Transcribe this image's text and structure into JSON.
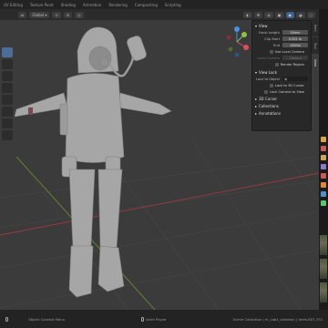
{
  "workspace_tabs": [
    "UV Editing",
    "Texture Paint",
    "Shading",
    "Animation",
    "Rendering",
    "Compositing",
    "Scripting"
  ],
  "viewport_header": {
    "orientation_label": "Global"
  },
  "sidebar": {
    "view_title": "View",
    "focal_length_label": "Focal Length",
    "focal_length_value": "50mm",
    "clip_start_label": "Clip Start",
    "clip_start_value": "0.001 m",
    "clip_end_label": "End",
    "clip_end_value": "1000m",
    "use_local_camera_label": "Use Local Camera",
    "local_camera_label": "Local Camera",
    "local_camera_value": "Camera",
    "render_region_label": "Render Region",
    "view_lock_title": "View Lock",
    "lock_to_object_label": "Lock to Object",
    "lock_to_3d_cursor_label": "Lock to 3D Cursor",
    "lock_camera_to_view_label": "Lock Camera to View",
    "cursor_title": "3D Cursor",
    "collections_title": "Collections",
    "annotations_title": "Annotations"
  },
  "vertical_tabs": [
    "Item",
    "Tool",
    "View"
  ],
  "status_bar": {
    "context_menu": "Object Context Menu",
    "player_label": "Anim Player",
    "scene_info": "Scene Collection | m_Lab1_skeleton | Verts:807,372"
  },
  "colors": {
    "viewport_bg": "#3b3b3b",
    "accent_blue": "#4772b3",
    "gizmo_x": "#e04a5d",
    "gizmo_y": "#8bc34a",
    "gizmo_z": "#4a8fe0"
  }
}
